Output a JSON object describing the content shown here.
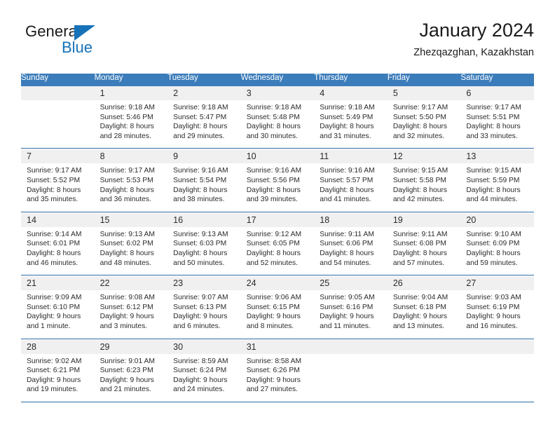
{
  "brand": {
    "name_top": "General",
    "name_bottom": "Blue",
    "color_blue": "#1672b8"
  },
  "header": {
    "title": "January 2024",
    "subtitle": "Zhezqazghan, Kazakhstan"
  },
  "theme": {
    "header_row_bg": "#3b7cba",
    "daynum_row_bg": "#f0f0f0",
    "separator_color": "#2e6da4"
  },
  "calendar": {
    "day_headers": [
      "Sunday",
      "Monday",
      "Tuesday",
      "Wednesday",
      "Thursday",
      "Friday",
      "Saturday"
    ],
    "weeks": [
      {
        "days": [
          {
            "num": "",
            "lines": []
          },
          {
            "num": "1",
            "lines": [
              "Sunrise: 9:18 AM",
              "Sunset: 5:46 PM",
              "Daylight: 8 hours",
              "and 28 minutes."
            ]
          },
          {
            "num": "2",
            "lines": [
              "Sunrise: 9:18 AM",
              "Sunset: 5:47 PM",
              "Daylight: 8 hours",
              "and 29 minutes."
            ]
          },
          {
            "num": "3",
            "lines": [
              "Sunrise: 9:18 AM",
              "Sunset: 5:48 PM",
              "Daylight: 8 hours",
              "and 30 minutes."
            ]
          },
          {
            "num": "4",
            "lines": [
              "Sunrise: 9:18 AM",
              "Sunset: 5:49 PM",
              "Daylight: 8 hours",
              "and 31 minutes."
            ]
          },
          {
            "num": "5",
            "lines": [
              "Sunrise: 9:17 AM",
              "Sunset: 5:50 PM",
              "Daylight: 8 hours",
              "and 32 minutes."
            ]
          },
          {
            "num": "6",
            "lines": [
              "Sunrise: 9:17 AM",
              "Sunset: 5:51 PM",
              "Daylight: 8 hours",
              "and 33 minutes."
            ]
          }
        ]
      },
      {
        "days": [
          {
            "num": "7",
            "lines": [
              "Sunrise: 9:17 AM",
              "Sunset: 5:52 PM",
              "Daylight: 8 hours",
              "and 35 minutes."
            ]
          },
          {
            "num": "8",
            "lines": [
              "Sunrise: 9:17 AM",
              "Sunset: 5:53 PM",
              "Daylight: 8 hours",
              "and 36 minutes."
            ]
          },
          {
            "num": "9",
            "lines": [
              "Sunrise: 9:16 AM",
              "Sunset: 5:54 PM",
              "Daylight: 8 hours",
              "and 38 minutes."
            ]
          },
          {
            "num": "10",
            "lines": [
              "Sunrise: 9:16 AM",
              "Sunset: 5:56 PM",
              "Daylight: 8 hours",
              "and 39 minutes."
            ]
          },
          {
            "num": "11",
            "lines": [
              "Sunrise: 9:16 AM",
              "Sunset: 5:57 PM",
              "Daylight: 8 hours",
              "and 41 minutes."
            ]
          },
          {
            "num": "12",
            "lines": [
              "Sunrise: 9:15 AM",
              "Sunset: 5:58 PM",
              "Daylight: 8 hours",
              "and 42 minutes."
            ]
          },
          {
            "num": "13",
            "lines": [
              "Sunrise: 9:15 AM",
              "Sunset: 5:59 PM",
              "Daylight: 8 hours",
              "and 44 minutes."
            ]
          }
        ]
      },
      {
        "days": [
          {
            "num": "14",
            "lines": [
              "Sunrise: 9:14 AM",
              "Sunset: 6:01 PM",
              "Daylight: 8 hours",
              "and 46 minutes."
            ]
          },
          {
            "num": "15",
            "lines": [
              "Sunrise: 9:13 AM",
              "Sunset: 6:02 PM",
              "Daylight: 8 hours",
              "and 48 minutes."
            ]
          },
          {
            "num": "16",
            "lines": [
              "Sunrise: 9:13 AM",
              "Sunset: 6:03 PM",
              "Daylight: 8 hours",
              "and 50 minutes."
            ]
          },
          {
            "num": "17",
            "lines": [
              "Sunrise: 9:12 AM",
              "Sunset: 6:05 PM",
              "Daylight: 8 hours",
              "and 52 minutes."
            ]
          },
          {
            "num": "18",
            "lines": [
              "Sunrise: 9:11 AM",
              "Sunset: 6:06 PM",
              "Daylight: 8 hours",
              "and 54 minutes."
            ]
          },
          {
            "num": "19",
            "lines": [
              "Sunrise: 9:11 AM",
              "Sunset: 6:08 PM",
              "Daylight: 8 hours",
              "and 57 minutes."
            ]
          },
          {
            "num": "20",
            "lines": [
              "Sunrise: 9:10 AM",
              "Sunset: 6:09 PM",
              "Daylight: 8 hours",
              "and 59 minutes."
            ]
          }
        ]
      },
      {
        "days": [
          {
            "num": "21",
            "lines": [
              "Sunrise: 9:09 AM",
              "Sunset: 6:10 PM",
              "Daylight: 9 hours",
              "and 1 minute."
            ]
          },
          {
            "num": "22",
            "lines": [
              "Sunrise: 9:08 AM",
              "Sunset: 6:12 PM",
              "Daylight: 9 hours",
              "and 3 minutes."
            ]
          },
          {
            "num": "23",
            "lines": [
              "Sunrise: 9:07 AM",
              "Sunset: 6:13 PM",
              "Daylight: 9 hours",
              "and 6 minutes."
            ]
          },
          {
            "num": "24",
            "lines": [
              "Sunrise: 9:06 AM",
              "Sunset: 6:15 PM",
              "Daylight: 9 hours",
              "and 8 minutes."
            ]
          },
          {
            "num": "25",
            "lines": [
              "Sunrise: 9:05 AM",
              "Sunset: 6:16 PM",
              "Daylight: 9 hours",
              "and 11 minutes."
            ]
          },
          {
            "num": "26",
            "lines": [
              "Sunrise: 9:04 AM",
              "Sunset: 6:18 PM",
              "Daylight: 9 hours",
              "and 13 minutes."
            ]
          },
          {
            "num": "27",
            "lines": [
              "Sunrise: 9:03 AM",
              "Sunset: 6:19 PM",
              "Daylight: 9 hours",
              "and 16 minutes."
            ]
          }
        ]
      },
      {
        "days": [
          {
            "num": "28",
            "lines": [
              "Sunrise: 9:02 AM",
              "Sunset: 6:21 PM",
              "Daylight: 9 hours",
              "and 19 minutes."
            ]
          },
          {
            "num": "29",
            "lines": [
              "Sunrise: 9:01 AM",
              "Sunset: 6:23 PM",
              "Daylight: 9 hours",
              "and 21 minutes."
            ]
          },
          {
            "num": "30",
            "lines": [
              "Sunrise: 8:59 AM",
              "Sunset: 6:24 PM",
              "Daylight: 9 hours",
              "and 24 minutes."
            ]
          },
          {
            "num": "31",
            "lines": [
              "Sunrise: 8:58 AM",
              "Sunset: 6:26 PM",
              "Daylight: 9 hours",
              "and 27 minutes."
            ]
          },
          {
            "num": "",
            "lines": []
          },
          {
            "num": "",
            "lines": []
          },
          {
            "num": "",
            "lines": []
          }
        ]
      }
    ]
  }
}
